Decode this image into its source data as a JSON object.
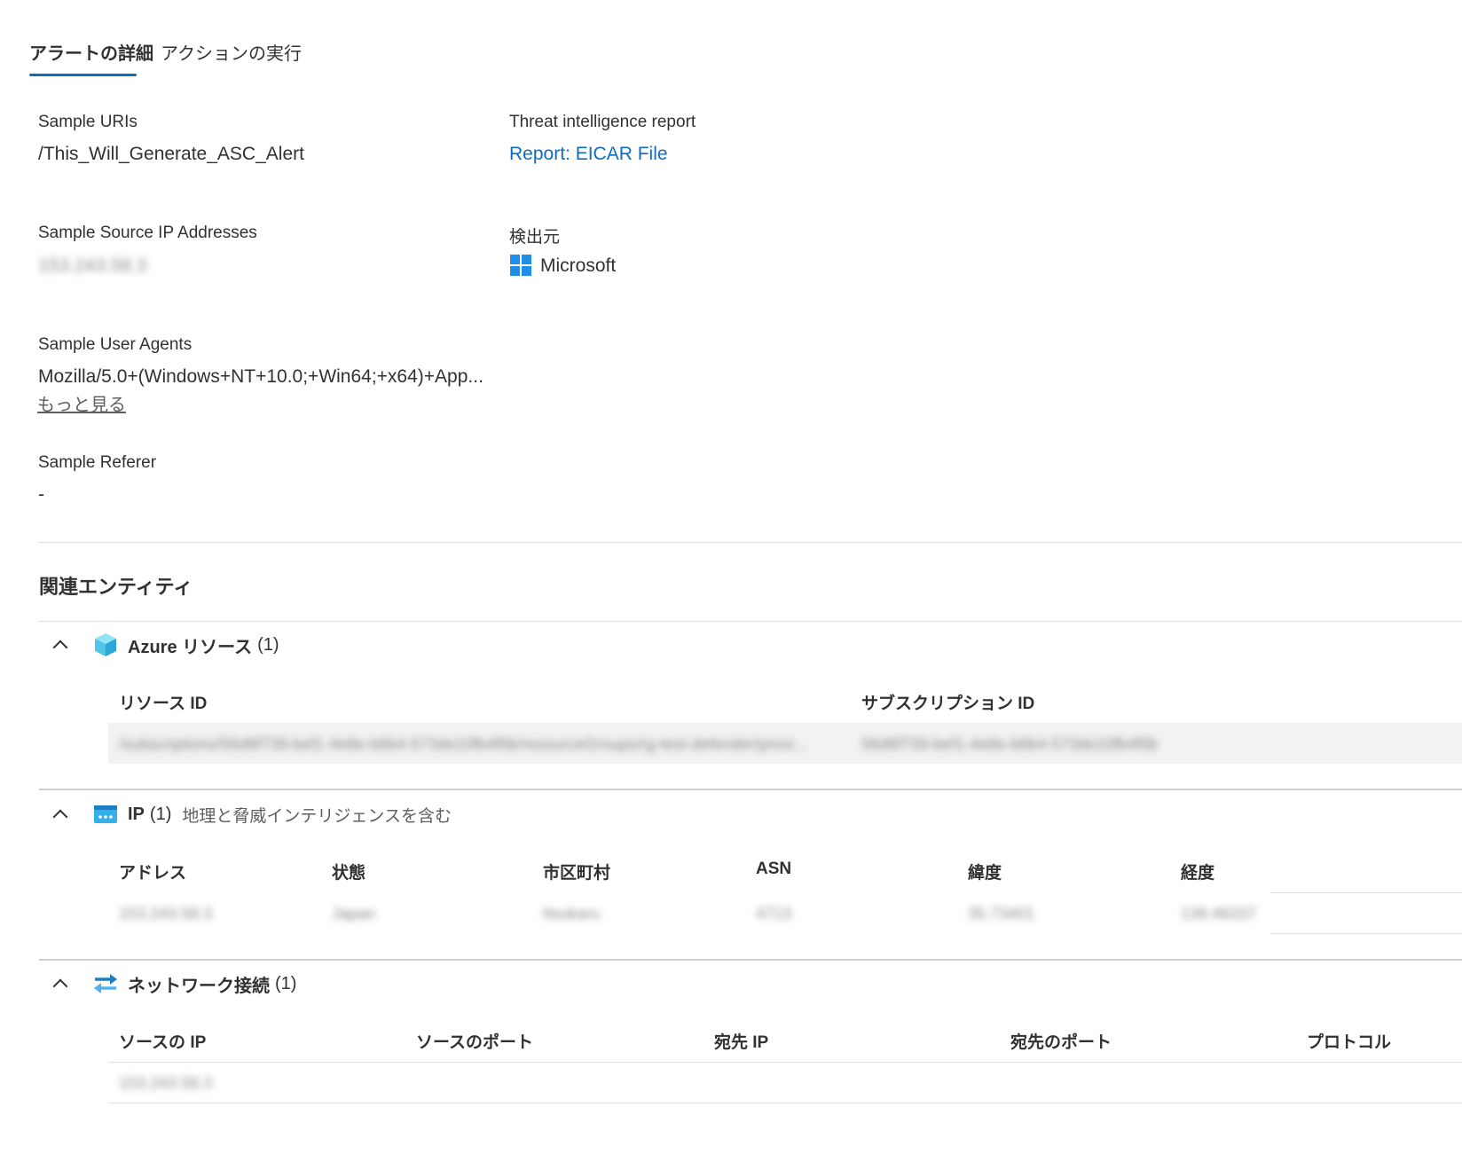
{
  "tabs": [
    {
      "label": "アラートの詳細",
      "active": true
    },
    {
      "label": "アクションの実行",
      "active": false
    }
  ],
  "details": {
    "sample_uris": {
      "label": "Sample URIs",
      "value": "/This_Will_Generate_ASC_Alert"
    },
    "threat_report": {
      "label": "Threat intelligence report",
      "value": "Report: EICAR File"
    },
    "source_ip": {
      "label": "Sample Source IP Addresses",
      "value": "153.243.58.3"
    },
    "detected_by": {
      "label": "検出元",
      "value": "Microsoft",
      "icon": "microsoft-logo"
    },
    "user_agents": {
      "label": "Sample User Agents",
      "value": "Mozilla/5.0+(Windows+NT+10.0;+Win64;+x64)+App...",
      "more": "もっと見る"
    },
    "referer": {
      "label": "Sample Referer",
      "value": "-"
    }
  },
  "related": {
    "title": "関連エンティティ",
    "azure": {
      "title": "Azure リソース",
      "count": "(1)",
      "icon": "cube-icon",
      "columns": [
        "リソース ID",
        "サブスクリプション ID"
      ],
      "rows": [
        [
          "/subscriptions/56d6f739-bef1-4e8e-b6b4-573de10fb4f0b/resourceGroups/rg-test-defender/provi...",
          "56d6f739-bef1-4e8e-b6b4-573de10fb4f0b"
        ]
      ]
    },
    "ip": {
      "title": "IP",
      "count": "(1)",
      "subtitle": "地理と脅威インテリジェンスを含む",
      "icon": "ip-address-icon",
      "columns": [
        "アドレス",
        "状態",
        "市区町村",
        "ASN",
        "緯度",
        "経度"
      ],
      "rows": [
        [
          "153.243.58.3",
          "Japan",
          "Itsukaru",
          "4713",
          "35.73401",
          "139.46337"
        ]
      ]
    },
    "network": {
      "title": "ネットワーク接続",
      "count": "(1)",
      "icon": "network-connection-icon",
      "columns": [
        "ソースの IP",
        "ソースのポート",
        "宛先 IP",
        "宛先のポート",
        "プロトコル"
      ],
      "rows": [
        [
          "153.243.58.3",
          "",
          "",
          "",
          ""
        ]
      ]
    }
  },
  "colors": {
    "accent": "#0f6cbd",
    "row_band": "#f3f2f1",
    "ms_logo": "#1e8ee8"
  }
}
